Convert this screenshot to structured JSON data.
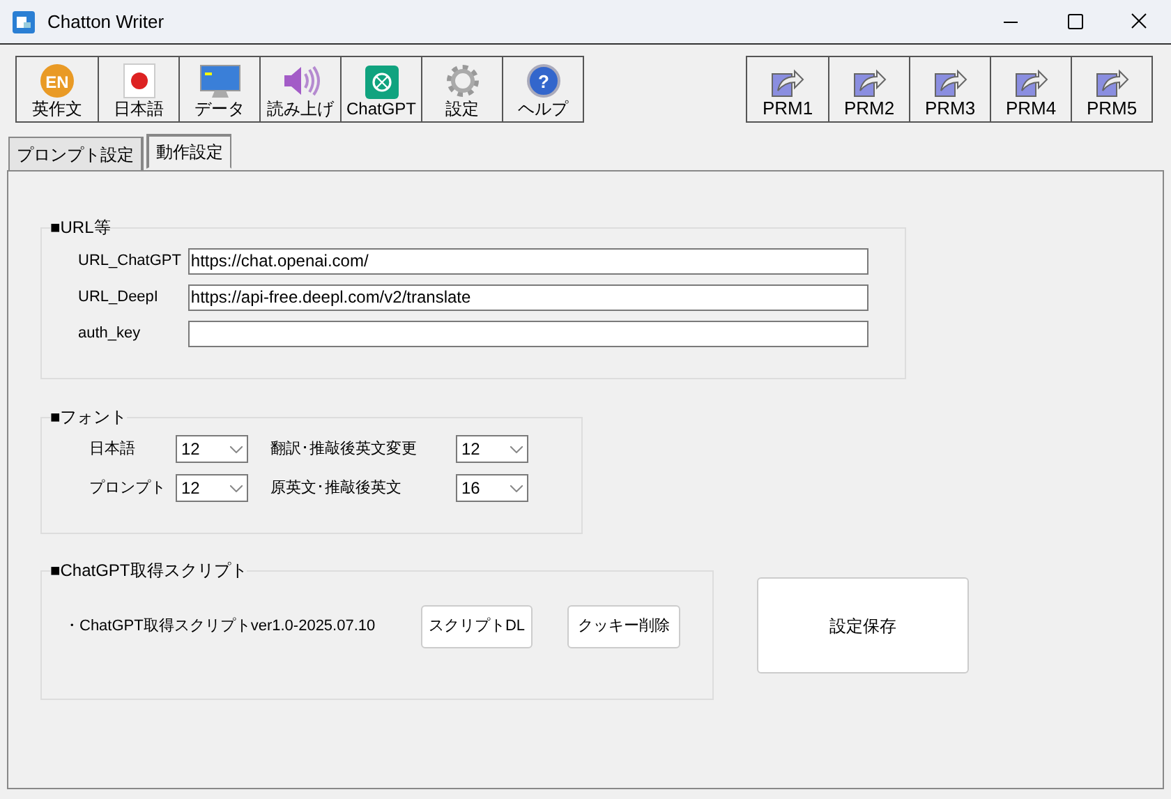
{
  "window": {
    "title": "Chatton Writer"
  },
  "toolbar": [
    {
      "kind": "en",
      "badge": "EN",
      "label": "英作文"
    },
    {
      "kind": "flag",
      "label": "日本語"
    },
    {
      "kind": "monitor",
      "label": "データ"
    },
    {
      "kind": "speaker",
      "label": "読み上げ"
    },
    {
      "kind": "chatgpt",
      "label": "ChatGPT"
    },
    {
      "kind": "gear",
      "label": "設定"
    },
    {
      "kind": "help",
      "badge": "?",
      "label": "ヘルプ"
    }
  ],
  "prm_buttons": [
    "PRM1",
    "PRM2",
    "PRM3",
    "PRM4",
    "PRM5"
  ],
  "tabs": [
    {
      "label": "プロンプト設定",
      "selected": false
    },
    {
      "label": "動作設定",
      "selected": true
    }
  ],
  "url_group": {
    "title": "■URL等",
    "fields": [
      {
        "label": "URL_ChatGPT",
        "value": "https://chat.openai.com/"
      },
      {
        "label": "URL_DeepI",
        "value": "https://api-free.deepl.com/v2/translate"
      },
      {
        "label": "auth_key"
      }
    ]
  },
  "font_group": {
    "title": "■フォント",
    "fields": [
      {
        "label": "日本語",
        "value": "12"
      },
      {
        "label": "翻訳･推敲後英文変更",
        "value": "12"
      },
      {
        "label": "プロンプト",
        "value": "12"
      },
      {
        "label": "原英文･推敲後英文",
        "value": "16"
      }
    ]
  },
  "script_group": {
    "title": "■ChatGPT取得スクリプト",
    "text": "・ChatGPT取得スクリプトver1.0-2025.07.10",
    "buttons": [
      "スクリプトDL",
      "クッキー削除"
    ]
  },
  "save_button": "設定保存"
}
